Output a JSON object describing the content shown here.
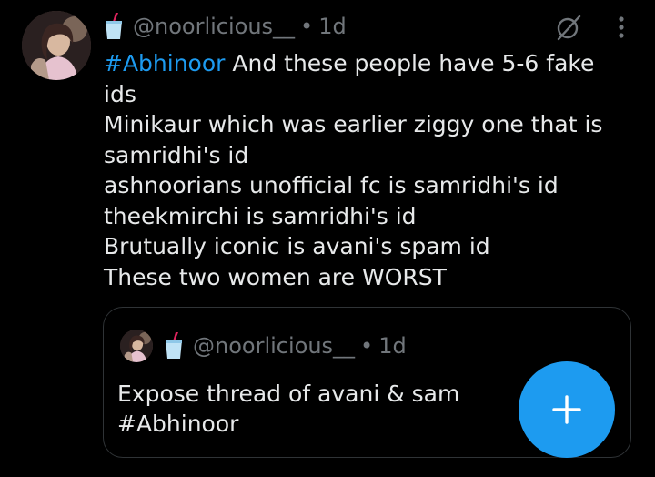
{
  "tweet": {
    "author_handle": "@noorlicious__",
    "separator": "•",
    "time_ago": "1d",
    "emoji_icon": "cup-with-straw-icon",
    "hashtag": "#Abhinoor",
    "first_line_rest": " And these people have 5-6 fake",
    "lines": [
      "ids",
      "Minikaur which was earlier ziggy one that is",
      "samridhi's id",
      "ashnoorians unofficial fc is samridhi's id",
      "theekmirchi is samridhi's id",
      "Brutually iconic is avani's spam id",
      "These two women are WORST"
    ]
  },
  "quoted_tweet": {
    "author_handle": "@noorlicious__",
    "separator": "•",
    "time_ago": "1d",
    "emoji_icon": "cup-with-straw-icon",
    "lines": [
      "Expose thread of avani & sam",
      "#Abhinoor"
    ]
  },
  "actions": {
    "grok_icon": "grok-icon",
    "more_icon": "more-options-icon",
    "compose_icon": "plus-icon"
  },
  "colors": {
    "background": "#000000",
    "text": "#e7e9ea",
    "secondary_text": "#71767b",
    "accent": "#1d9bf0",
    "border": "#2f3336"
  }
}
